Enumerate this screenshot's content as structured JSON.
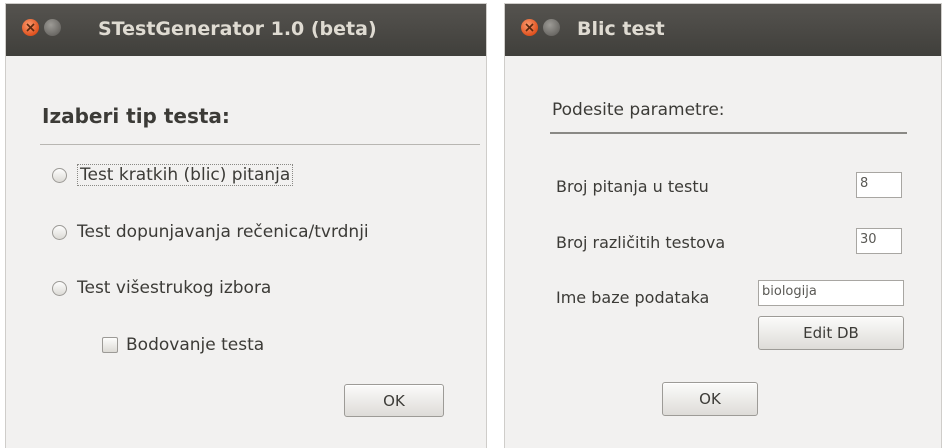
{
  "win1": {
    "title": "STestGenerator 1.0 (beta)",
    "heading": "Izaberi tip testa:",
    "options": [
      {
        "label": "Test kratkih (blic) pitanja"
      },
      {
        "label": "Test dopunjavanja rečenica/tvrdnji"
      },
      {
        "label": "Test višestrukog izbora"
      }
    ],
    "scoring_label": "Bodovanje testa",
    "ok_label": "OK"
  },
  "win2": {
    "title": "Blic test",
    "heading": "Podesite parametre:",
    "questions_label": "Broj pitanja u testu",
    "questions_value": "8",
    "tests_label": "Broj različitih testova",
    "tests_value": "30",
    "db_label": "Ime baze podataka",
    "db_value": "biologija",
    "edit_db_label": "Edit DB",
    "ok_label": "OK"
  },
  "colors": {
    "titlebar": "#403f3b",
    "close": "#e0521f",
    "window_bg": "#f2f1f0"
  }
}
